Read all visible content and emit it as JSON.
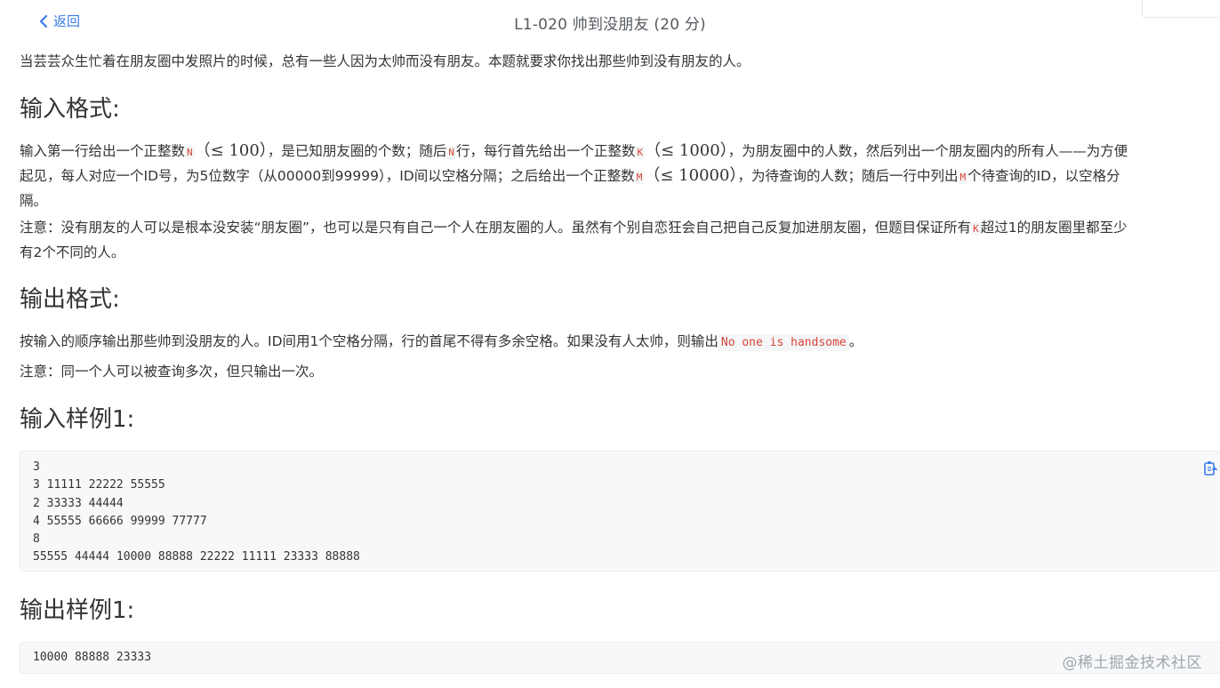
{
  "header": {
    "back_label": "返回",
    "title": "L1-020 帅到没朋友 (20 分)"
  },
  "intro": "当芸芸众生忙着在朋友圈中发照片的时候，总有一些人因为太帅而没有朋友。本题就要求你找出那些帅到没有朋友的人。",
  "input_format": {
    "heading": "输入格式:",
    "p1": {
      "t1": "输入第一行给出一个正整数",
      "v_n": "N",
      "m1": "（≤ 100）",
      "t2": "，是已知朋友圈的个数；随后",
      "v_n2": "N",
      "t3": "行，每行首先给出一个正整数",
      "v_k": "K",
      "m2": "（≤ 1000）",
      "t4": "，为朋友圈中的人数，然后列出一个朋友圈内的所有人——为方便",
      "line2_a": "起见，每人对应一个ID号，为5位数字（从00000到99999），ID间以空格分隔；之后给出一个正整数",
      "v_m": "M",
      "m3": "（≤ 10000）",
      "line2_b": "，为待查询的人数；随后一行中列出",
      "v_m2": "M",
      "line2_c": "个待查询的ID，以空格分",
      "line3": "隔。"
    },
    "p2": {
      "a": "注意：没有朋友的人可以是根本没安装“朋友圈”，也可以是只有自己一个人在朋友圈的人。虽然有个别自恋狂会自己把自己反复加进朋友圈，但题目保证所有",
      "v_k": "K",
      "b": "超过1的朋友圈里都至少",
      "line2": "有2个不同的人。"
    }
  },
  "output_format": {
    "heading": "输出格式:",
    "p1_a": "按输入的顺序输出那些帅到没朋友的人。ID间用1个空格分隔，行的首尾不得有多余空格。如果没有人太帅，则输出",
    "p1_code": "No one is handsome",
    "p1_b": "。",
    "p2": "注意：同一个人可以被查询多次，但只输出一次。"
  },
  "sample_input": {
    "heading": "输入样例1:",
    "lines": [
      "3",
      "3 11111 22222 55555",
      "2 33333 44444",
      "4 55555 66666 99999 77777",
      "8",
      "55555 44444 10000 88888 22222 11111 23333 88888"
    ]
  },
  "sample_output": {
    "heading": "输出样例1:",
    "lines": [
      "10000 88888 23333"
    ]
  },
  "watermark": "@稀土掘金技术社区",
  "colors": {
    "accent": "#3a7be6",
    "token_red": "#d4453a",
    "code_bg": "#f7f8f9"
  },
  "icons": {
    "back": "chevron-left-icon",
    "copy": "copy-clipboard-icon"
  }
}
